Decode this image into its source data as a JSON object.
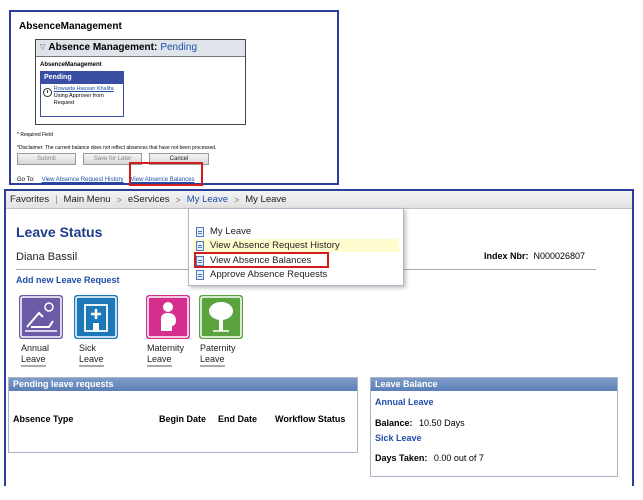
{
  "top_panel": {
    "title": "AbsenceManagement",
    "pending_box": {
      "header_prefix": "Absence Management:",
      "header_status": "Pending",
      "section_label": "AbsenceManagement",
      "card_title": "Pending",
      "approver_name": "Rowaida Hassan Khalifa",
      "approver_note": "Using Approver from Request"
    },
    "required_field": "* Required Field",
    "disclaimer": "*Disclaimer: The current balance does not reflect absences that have not been processed.",
    "buttons": {
      "submit": "Submit",
      "save_later": "Save for Later",
      "cancel": "Cancel"
    },
    "goto": {
      "label": "Go To:",
      "history_link": "View Absence Request History",
      "balances_link": "View Absence Balances"
    }
  },
  "nav": {
    "favorites": "Favorites",
    "main_menu": "Main Menu",
    "eservices": "eServices",
    "my_leave": "My Leave",
    "my_leave_crumb": "My Leave",
    "sep_gt": ">"
  },
  "dropdown": {
    "items": [
      {
        "label": "My Leave"
      },
      {
        "label": "View Absence Request History"
      },
      {
        "label": "View Absence Balances"
      },
      {
        "label": "Approve Absence Requests"
      }
    ]
  },
  "leave_page": {
    "title": "Leave Status",
    "employee_name": "Diana Bassil",
    "index_label": "Index Nbr:",
    "index_value": "N000026807",
    "add_new": "Add new Leave Request",
    "tiles": [
      {
        "line1": "Annual",
        "line2": "Leave",
        "color": "#6b5aa6"
      },
      {
        "line1": "Sick",
        "line2": "Leave",
        "color": "#1c78b8"
      },
      {
        "line1": "Maternity",
        "line2": "Leave",
        "color": "#d62e8d"
      },
      {
        "line1": "Paternity",
        "line2": "Leave",
        "color": "#5aa33f"
      }
    ],
    "pending": {
      "header": "Pending leave requests",
      "col_type": "Absence Type",
      "col_begin": "Begin Date",
      "col_end": "End Date",
      "col_status": "Workflow Status"
    },
    "balance": {
      "header": "Leave Balance",
      "annual_label": "Annual Leave",
      "balance_label": "Balance:",
      "balance_value": "10.50 Days",
      "sick_label": "Sick Leave",
      "days_taken_label": "Days Taken:",
      "days_taken_value": "0.00 out of 7"
    }
  },
  "colors": {
    "frame_blue": "#2b3f9a",
    "link_blue": "#1f4fa8",
    "highlight_red": "#d21b1b",
    "section_header": "#6a8cc0"
  }
}
